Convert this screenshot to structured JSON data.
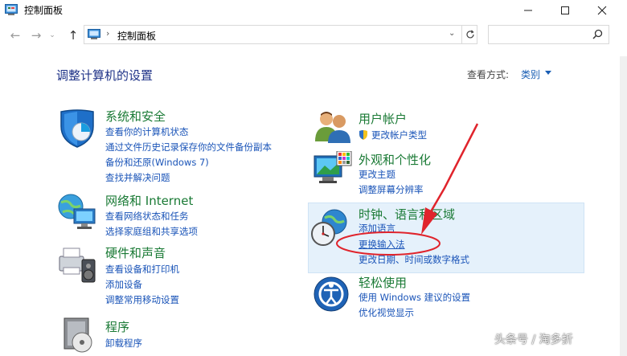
{
  "window": {
    "title": "控制面板"
  },
  "address": {
    "location": "控制面板",
    "search_placeholder": ""
  },
  "page": {
    "title": "调整计算机的设置",
    "view_label": "查看方式:",
    "view_value": "类别"
  },
  "left_categories": [
    {
      "title": "系统和安全",
      "links": [
        "查看你的计算机状态",
        "通过文件历史记录保存你的文件备份副本",
        "备份和还原(Windows 7)",
        "查找并解决问题"
      ]
    },
    {
      "title": "网络和 Internet",
      "links": [
        "查看网络状态和任务",
        "选择家庭组和共享选项"
      ]
    },
    {
      "title": "硬件和声音",
      "links": [
        "查看设备和打印机",
        "添加设备",
        "调整常用移动设置"
      ]
    },
    {
      "title": "程序",
      "links": [
        "卸载程序"
      ]
    }
  ],
  "right_categories": [
    {
      "title": "用户帐户",
      "links": [
        "更改帐户类型"
      ]
    },
    {
      "title": "外观和个性化",
      "links": [
        "更改主题",
        "调整屏幕分辨率"
      ]
    },
    {
      "title": "时钟、语言和区域",
      "links": [
        "添加语言",
        "更换输入法",
        "更改日期、时间或数字格式"
      ]
    },
    {
      "title": "轻松使用",
      "links": [
        "使用 Windows 建议的设置",
        "优化视觉显示"
      ]
    }
  ],
  "watermark": {
    "text": "头条号 / 淘多折"
  },
  "colors": {
    "accent": "#1a54b8",
    "category_green": "#1a7a35",
    "highlight": "#e5f1fb",
    "annotation_red": "#e0242c"
  }
}
